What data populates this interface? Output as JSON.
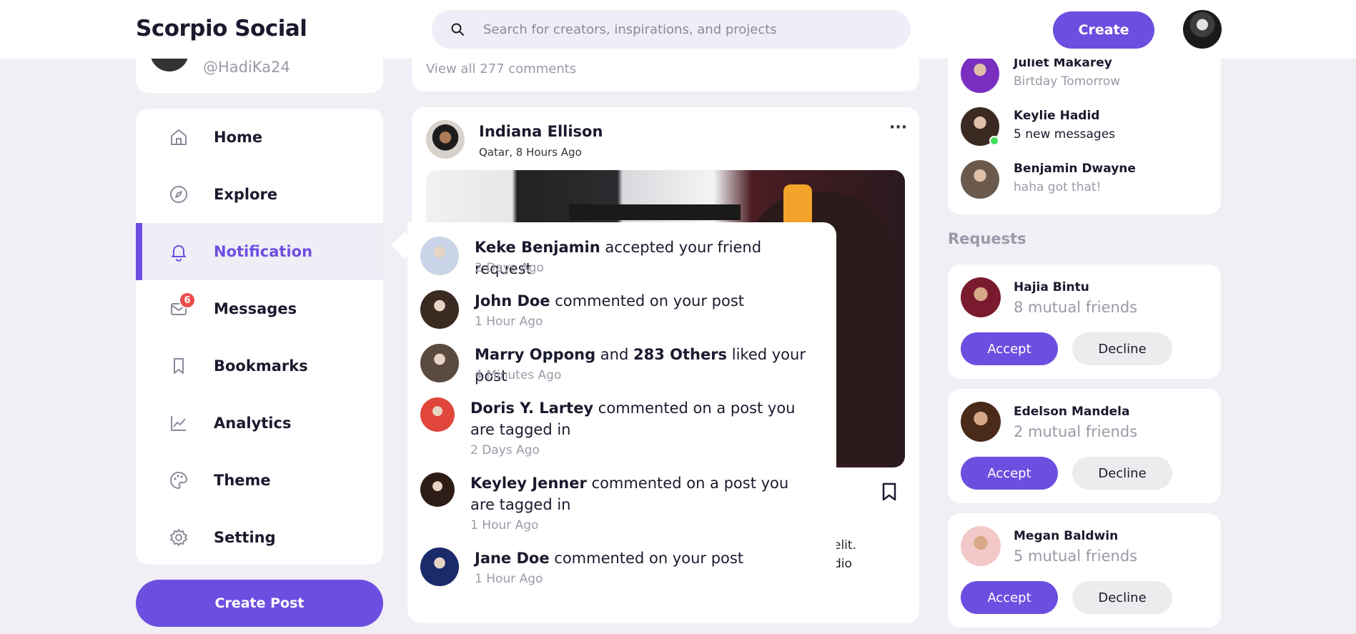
{
  "header": {
    "logo": "Scorpio Social",
    "search_placeholder": "Search for creators, inspirations, and projects",
    "create_label": "Create"
  },
  "profile": {
    "handle": "@HadiKa24"
  },
  "nav": {
    "items": [
      {
        "label": "Home",
        "icon": "home-icon"
      },
      {
        "label": "Explore",
        "icon": "compass-icon"
      },
      {
        "label": "Notification",
        "icon": "bell-icon",
        "active": true
      },
      {
        "label": "Messages",
        "icon": "mail-icon",
        "badge": "6"
      },
      {
        "label": "Bookmarks",
        "icon": "bookmark-icon"
      },
      {
        "label": "Analytics",
        "icon": "chart-icon"
      },
      {
        "label": "Theme",
        "icon": "palette-icon"
      },
      {
        "label": "Setting",
        "icon": "gear-icon"
      }
    ],
    "create_post_label": "Create Post"
  },
  "feed": {
    "view_all_comments": "View all 277 comments",
    "post": {
      "author": "Indiana Ellison",
      "meta": "Qatar, 8 Hours Ago",
      "more": "···",
      "caption_line1": "elit.",
      "caption_line2": "dio"
    }
  },
  "notifications": [
    {
      "name": "Keke Benjamin",
      "text": " accepted your friend request",
      "time": "2 Days Ago",
      "avatar_color": "#c9d4e6"
    },
    {
      "name": "John Doe",
      "text": " commented on your post",
      "time": "1 Hour Ago",
      "avatar_color": "#3a2a22"
    },
    {
      "name": "Marry Oppong",
      "mid": " and ",
      "name2": "283 Others",
      "text": " liked your post",
      "time": "4 Minutes Ago",
      "avatar_color": "#5a4a40"
    },
    {
      "name": "Doris Y. Lartey",
      "text": " commented on a post you are tagged in",
      "time": "2 Days Ago",
      "avatar_color": "#e0463a"
    },
    {
      "name": "Keyley Jenner",
      "text": " commented on a post you are tagged in",
      "time": "1 Hour Ago",
      "avatar_color": "#2e1d16"
    },
    {
      "name": "Jane Doe",
      "text": " commented on your post",
      "time": "1 Hour Ago",
      "avatar_color": "#1b2a6a"
    }
  ],
  "contacts": [
    {
      "name": "Juliet Makarey",
      "status": "Birtday Tomorrow",
      "avatar_color": "#7a2fc0"
    },
    {
      "name": "Keylie Hadid",
      "status": "5 new messages",
      "avatar_color": "#3a2a22"
    },
    {
      "name": "Benjamin Dwayne",
      "status": "haha got that!",
      "avatar_color": "#6b5a4c"
    }
  ],
  "requests": {
    "title": "Requests",
    "accept_label": "Accept",
    "decline_label": "Decline",
    "items": [
      {
        "name": "Hajia Bintu",
        "mutual": "8 mutual friends",
        "avatar_color": "#7a1a2e"
      },
      {
        "name": "Edelson Mandela",
        "mutual": "2 mutual friends",
        "avatar_color": "#4a2a18"
      },
      {
        "name": "Megan Baldwin",
        "mutual": "5 mutual friends",
        "avatar_color": "#f3c8c8"
      }
    ]
  },
  "colors": {
    "accent": "#6c4fe0",
    "background": "#f0eff6",
    "badge": "#ee4c4c",
    "online": "#3ee05a"
  }
}
